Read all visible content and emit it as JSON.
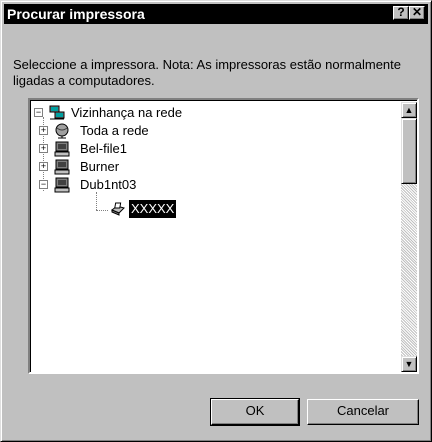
{
  "window": {
    "title": "Procurar impressora",
    "help_label": "?",
    "close_label": "✕"
  },
  "description": "Seleccione a impressora. Nota: As impressoras estão normalmente ligadas a computadores.",
  "tree": {
    "root": {
      "label": "Vizinhança na rede",
      "expander": "−",
      "icon": "network-neighborhood-icon"
    },
    "items": [
      {
        "label": "Toda a rede",
        "expander": "+",
        "icon": "globe-icon"
      },
      {
        "label": "Bel-file1",
        "expander": "+",
        "icon": "computer-icon"
      },
      {
        "label": "Burner",
        "expander": "+",
        "icon": "computer-icon"
      },
      {
        "label": "Dub1nt03",
        "expander": "−",
        "icon": "computer-icon"
      }
    ],
    "printer": {
      "label": "XXXXX",
      "icon": "printer-icon",
      "selected": true
    }
  },
  "scrollbar": {
    "up_arrow": "▲",
    "down_arrow": "▼"
  },
  "buttons": {
    "ok": "OK",
    "cancel": "Cancelar"
  },
  "colors": {
    "titlebar": "#000000",
    "face": "#c0c0c0",
    "selection": "#000000"
  }
}
